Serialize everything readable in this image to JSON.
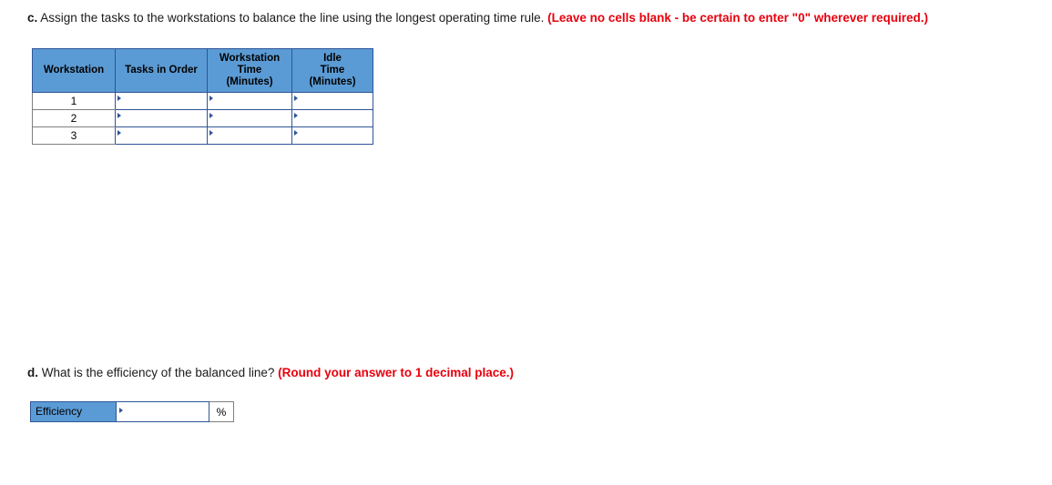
{
  "part_c": {
    "label": "c.",
    "text": " Assign the tasks to the workstations to balance the line using the longest operating time rule. ",
    "note": "(Leave no cells blank - be certain to enter \"0\" wherever required.)"
  },
  "part_d": {
    "label": "d.",
    "text": " What is the efficiency of the balanced line? ",
    "note": "(Round your answer to 1 decimal place.)"
  },
  "workstation_table": {
    "headers": [
      {
        "lines": [
          "Workstation"
        ]
      },
      {
        "lines": [
          "Tasks in Order"
        ]
      },
      {
        "lines": [
          "Workstation",
          "Time",
          "(Minutes)"
        ]
      },
      {
        "lines": [
          "Idle",
          "Time",
          "(Minutes)"
        ]
      }
    ],
    "rows": [
      {
        "workstation": "1",
        "tasks": "",
        "ws_time": "",
        "idle_time": ""
      },
      {
        "workstation": "2",
        "tasks": "",
        "ws_time": "",
        "idle_time": ""
      },
      {
        "workstation": "3",
        "tasks": "",
        "ws_time": "",
        "idle_time": ""
      }
    ]
  },
  "efficiency": {
    "label": "Efficiency",
    "value": "",
    "unit": "%"
  },
  "colors": {
    "header_fill": "#5b9bd5",
    "border": "#2f5597",
    "note_red": "#e8000d"
  }
}
